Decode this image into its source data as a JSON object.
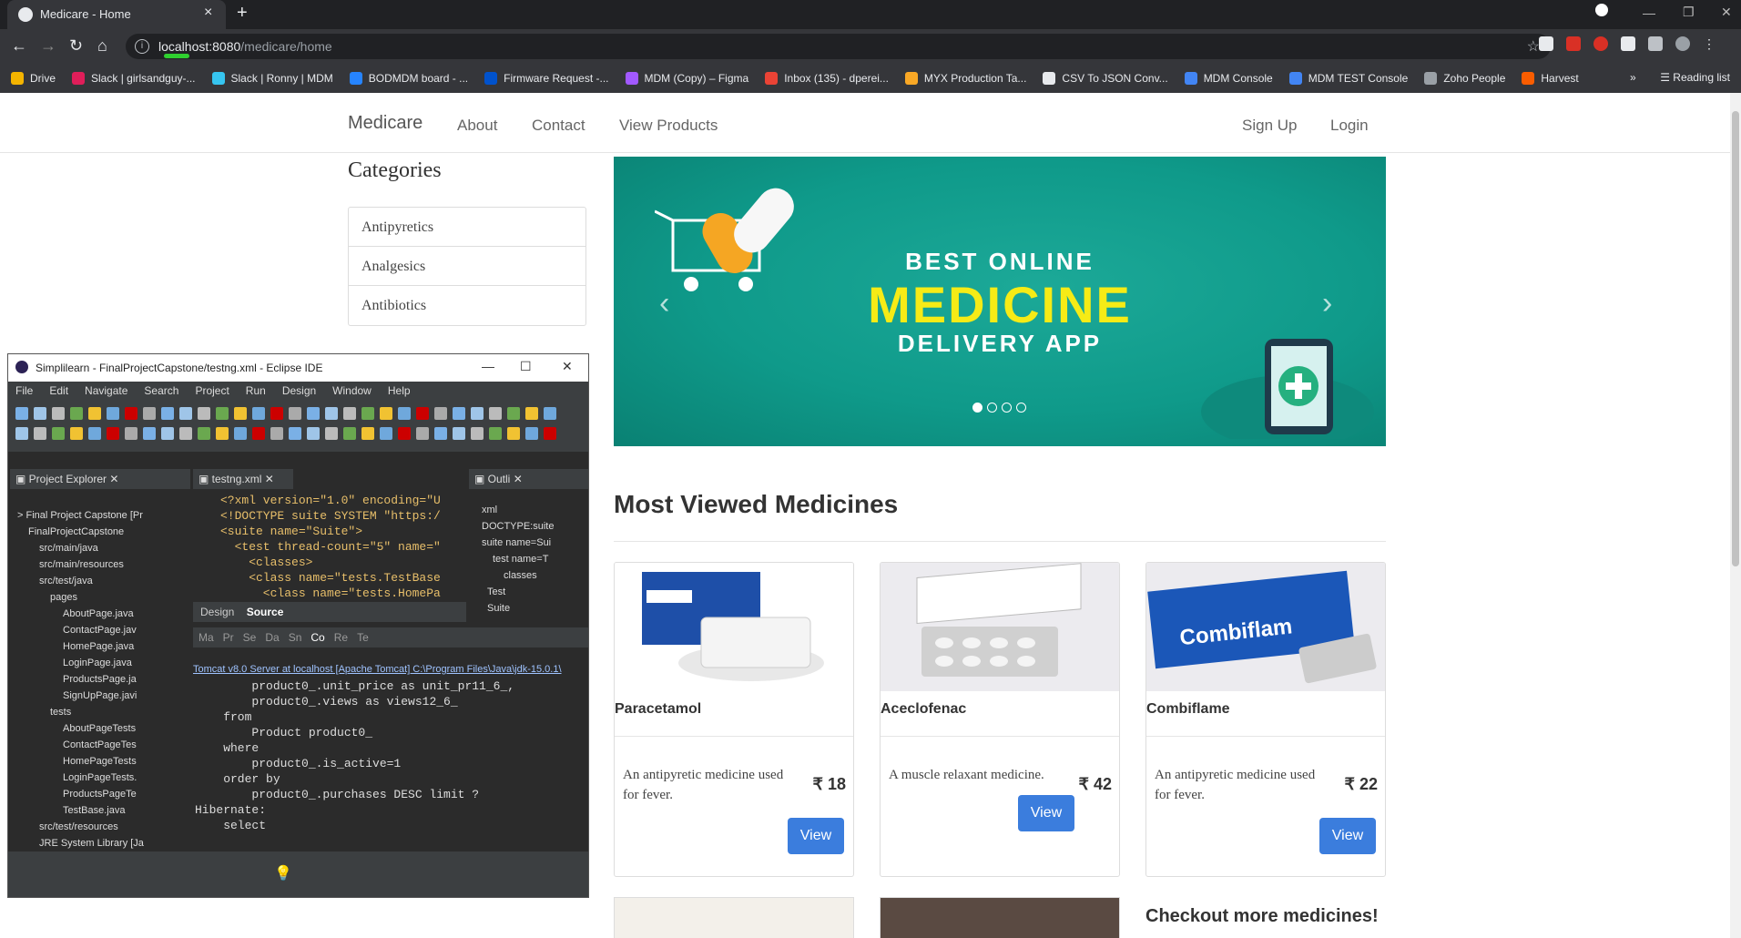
{
  "browser": {
    "tab_title": "Medicare - Home",
    "url_host": "localhost:8080",
    "url_path": "/medicare/home",
    "bookmarks": [
      {
        "label": "Drive",
        "color": "#f4b400"
      },
      {
        "label": "Slack | girlsandguy-...",
        "color": "#e01e5a"
      },
      {
        "label": "Slack | Ronny | MDM",
        "color": "#36c5f0"
      },
      {
        "label": "BODMDM board - ...",
        "color": "#2684ff"
      },
      {
        "label": "Firmware Request -...",
        "color": "#0052cc"
      },
      {
        "label": "MDM (Copy) – Figma",
        "color": "#a259ff"
      },
      {
        "label": "Inbox (135) - dperei...",
        "color": "#ea4335"
      },
      {
        "label": "MYX Production Ta...",
        "color": "#f9a825"
      },
      {
        "label": "CSV To JSON Conv...",
        "color": "#e8eaed"
      },
      {
        "label": "MDM Console",
        "color": "#4285f4"
      },
      {
        "label": "MDM TEST Console",
        "color": "#4285f4"
      },
      {
        "label": "Zoho People",
        "color": "#9aa0a6"
      },
      {
        "label": "Harvest",
        "color": "#fa5d00"
      }
    ],
    "more_bookmarks": "»",
    "reading_list": "Reading list"
  },
  "site": {
    "brand": "Medicare",
    "nav_links": [
      "About",
      "Contact",
      "View Products"
    ],
    "right_links": [
      "Sign Up",
      "Login"
    ]
  },
  "categories": {
    "heading": "Categories",
    "items": [
      "Antipyretics",
      "Analgesics",
      "Antibiotics"
    ]
  },
  "banner": {
    "line1": "BEST ONLINE",
    "line2": "MEDICINE",
    "line3": "DELIVERY APP",
    "slide_count": 4,
    "active_slide": 1
  },
  "most_viewed": {
    "heading": "Most Viewed Medicines",
    "view_label": "View",
    "products": [
      {
        "name": "Paracetamol",
        "description": "An antipyretic medicine used for fever.",
        "price": "₹ 18"
      },
      {
        "name": "Aceclofenac",
        "description": "A muscle relaxant medicine.",
        "price": "₹ 42"
      },
      {
        "name": "Combiflame",
        "description": "An antipyretic medicine used for fever.",
        "price": "₹ 22"
      }
    ],
    "checkout_more": "Checkout more medicines!"
  },
  "eclipse": {
    "title": "Simplilearn - FinalProjectCapstone/testng.xml - Eclipse IDE",
    "menu": [
      "File",
      "Edit",
      "Navigate",
      "Search",
      "Project",
      "Run",
      "Design",
      "Window",
      "Help"
    ],
    "project_explorer_tab": "Project Explorer",
    "editor_tab": "testng.xml",
    "outline_tab": "Outli",
    "tree": [
      "> Final Project Capstone [Pr",
      "FinalProjectCapstone",
      "src/main/java",
      "src/main/resources",
      "src/test/java",
      "pages",
      "AboutPage.java",
      "ContactPage.jav",
      "HomePage.java",
      "LoginPage.java",
      "ProductsPage.ja",
      "SignUpPage.javi",
      "tests",
      "AboutPageTests",
      "ContactPageTes",
      "HomePageTests",
      "LoginPageTests.",
      "ProductsPageTe",
      "TestBase.java",
      "src/test/resources",
      "JRE System Library [Ja"
    ],
    "xml_lines": [
      "<?xml version=\"1.0\" encoding=\"U",
      "<!DOCTYPE suite SYSTEM \"https:/",
      "<suite name=\"Suite\">",
      "  <test thread-count=\"5\" name=\"",
      "    <classes>",
      "    <class name=\"tests.TestBase",
      "      <class name=\"tests.HomePa"
    ],
    "editor_bottom_tabs": [
      "Design",
      "Source"
    ],
    "outline": [
      "xml",
      "DOCTYPE:suite",
      "suite name=Sui",
      "test name=T",
      "classes",
      "Test",
      "Suite"
    ],
    "console_tabs": [
      "Ma",
      "Pr",
      "Se",
      "Da",
      "Sn",
      "Co",
      "Re",
      "Te"
    ],
    "console_server": "Tomcat v8.0 Server at localhost [Apache Tomcat] C:\\Program Files\\Java\\jdk-15.0.1\\",
    "console_lines": [
      "        product0_.unit_price as unit_pr11_6_,",
      "        product0_.views as views12_6_",
      "    from",
      "        Product product0_",
      "    where",
      "        product0_.is_active=1",
      "    order by",
      "        product0_.purchases DESC limit ?",
      "Hibernate:",
      "    select"
    ]
  }
}
